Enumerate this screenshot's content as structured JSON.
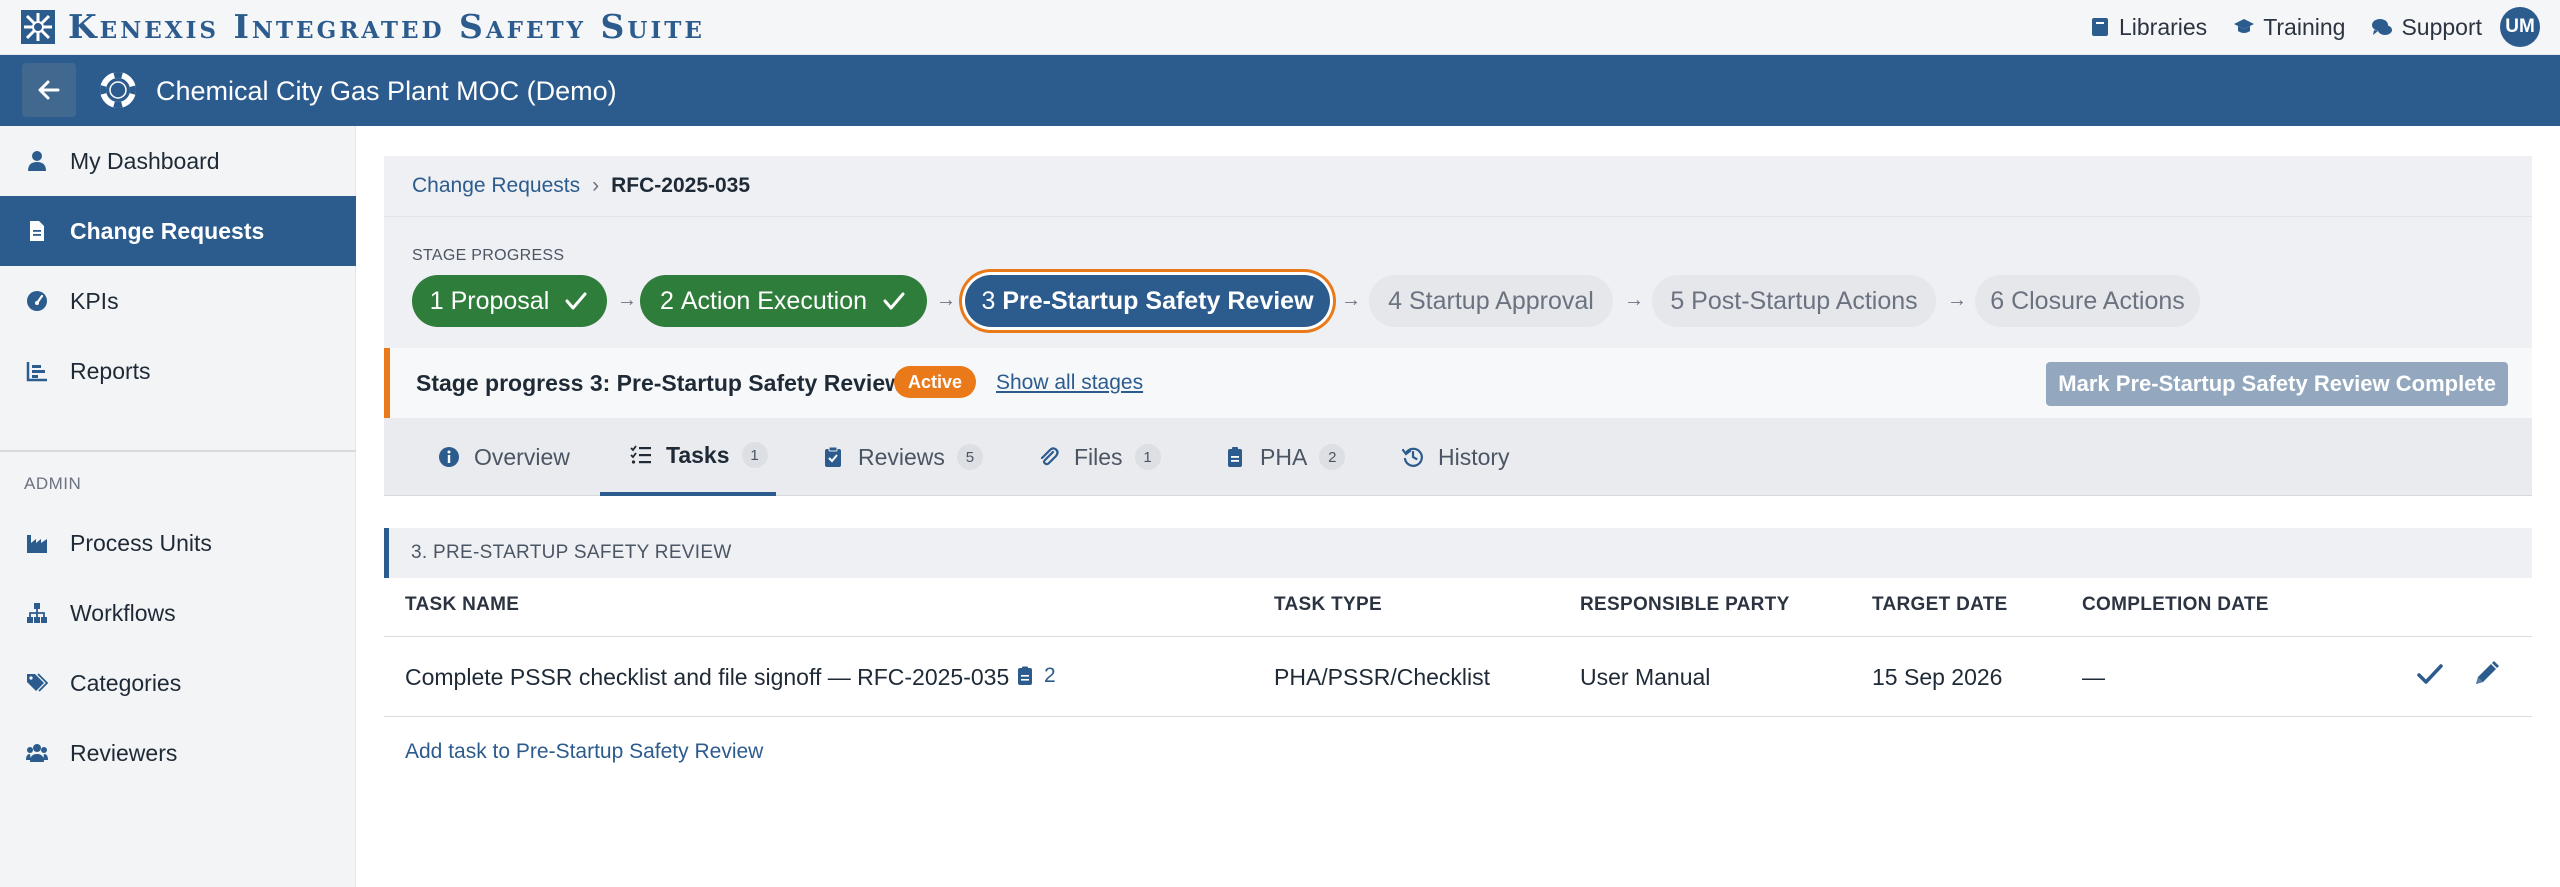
{
  "app": {
    "brand": "Kenexis Integrated Safety Suite",
    "top_links": [
      "Libraries",
      "Training",
      "Support"
    ],
    "user_initials": "UM"
  },
  "project": {
    "title": "Chemical City Gas Plant MOC (Demo)"
  },
  "sidebar": {
    "items": [
      "My Dashboard",
      "Change Requests",
      "KPIs",
      "Reports"
    ],
    "active_index": 1,
    "admin_label": "ADMIN",
    "admin_items": [
      "Process Units",
      "Workflows",
      "Categories",
      "Reviewers"
    ]
  },
  "breadcrumb": {
    "parent": "Change Requests",
    "separator": "›",
    "current": "RFC-2025-035"
  },
  "stages": {
    "label": "STAGE PROGRESS",
    "arrow": "→",
    "items": [
      {
        "number": "1",
        "name": "Proposal",
        "state": "done"
      },
      {
        "number": "2",
        "name": "Action Execution",
        "state": "done"
      },
      {
        "number": "3",
        "name": "Pre-Startup Safety Review",
        "state": "current"
      },
      {
        "number": "4",
        "name": "Startup Approval",
        "state": "pending"
      },
      {
        "number": "5",
        "name": "Post-Startup Actions",
        "state": "pending"
      },
      {
        "number": "6",
        "name": "Closure Actions",
        "state": "pending"
      }
    ]
  },
  "stage_bar": {
    "text": "Stage progress 3: Pre-Startup Safety Review",
    "badge": "Active",
    "show_all": "Show all stages",
    "mark_button": "Mark Pre-Startup Safety Review Complete"
  },
  "tabs": [
    {
      "label": "Overview",
      "count": "",
      "icon": "info-icon"
    },
    {
      "label": "Tasks",
      "count": "1",
      "icon": "task-list-icon"
    },
    {
      "label": "Reviews",
      "count": "5",
      "icon": "clipboard-check-icon"
    },
    {
      "label": "Files",
      "count": "1",
      "icon": "paperclip-icon"
    },
    {
      "label": "PHA",
      "count": "2",
      "icon": "document-icon"
    },
    {
      "label": "History",
      "count": "",
      "icon": "history-icon"
    }
  ],
  "active_tab": "Tasks",
  "section": {
    "title": "3. PRE-STARTUP SAFETY REVIEW",
    "columns": [
      "TASK NAME",
      "TASK TYPE",
      "RESPONSIBLE PARTY",
      "TARGET DATE",
      "COMPLETION DATE"
    ],
    "rows": [
      {
        "task_name": "Complete PSSR checklist and file signoff — RFC-2025-035",
        "doc_count": "2",
        "task_type": "PHA/PSSR/Checklist",
        "responsible_party": "User Manual",
        "target_date": "15 Sep 2026",
        "completion_date": "—"
      }
    ],
    "add_task": "Add task to Pre-Startup Safety Review"
  },
  "colors": {
    "brand_blue": "#2c5b8e",
    "done_green": "#2e7d3a",
    "active_orange": "#ea7a19",
    "disabled_button": "#93a8bf"
  }
}
